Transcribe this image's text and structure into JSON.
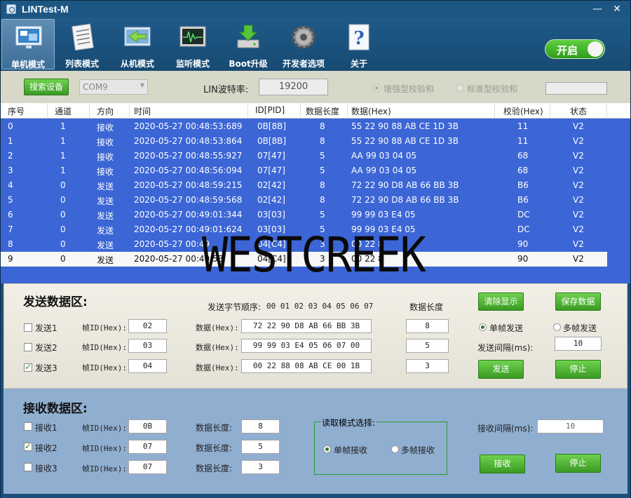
{
  "window": {
    "title": "LINTest-M",
    "minimize": "—",
    "close": "✕"
  },
  "toolbar": {
    "items": [
      {
        "label": "单机模式",
        "icon": "monitor-windows-icon"
      },
      {
        "label": "列表模式",
        "icon": "notebook-list-icon"
      },
      {
        "label": "从机模式",
        "icon": "arrow-window-icon"
      },
      {
        "label": "监听模式",
        "icon": "oscilloscope-icon"
      },
      {
        "label": "Boot升级",
        "icon": "download-disk-icon"
      },
      {
        "label": "开发者选项",
        "icon": "gear-icon"
      },
      {
        "label": "关于",
        "icon": "question-icon"
      }
    ],
    "toggle_label": "开启"
  },
  "device": {
    "search_button": "搜索设备",
    "port": "COM9",
    "baud_label": "LIN波特率:",
    "baud_value": "19200",
    "checksum_enhanced": "增强型校验和",
    "checksum_standard": "标准型校验和"
  },
  "table": {
    "columns": [
      "序号",
      "通道",
      "方向",
      "时间",
      "ID[PID]",
      "数据长度",
      "数据(Hex)",
      "校验(Hex)",
      "状态"
    ],
    "rows": [
      [
        "0",
        "1",
        "接收",
        "2020-05-27 00:48:53:689",
        "0B[8B]",
        "8",
        "55 22 90 88 AB CE 1D 3B",
        "11",
        "V2"
      ],
      [
        "1",
        "1",
        "接收",
        "2020-05-27 00:48:53:864",
        "0B[8B]",
        "8",
        "55 22 90 88 AB CE 1D 3B",
        "11",
        "V2"
      ],
      [
        "2",
        "1",
        "接收",
        "2020-05-27 00:48:55:927",
        "07[47]",
        "5",
        "AA 99 03 04 05",
        "68",
        "V2"
      ],
      [
        "3",
        "1",
        "接收",
        "2020-05-27 00:48:56:094",
        "07[47]",
        "5",
        "AA 99 03 04 05",
        "68",
        "V2"
      ],
      [
        "4",
        "0",
        "发送",
        "2020-05-27 00:48:59:215",
        "02[42]",
        "8",
        "72 22 90 D8 AB 66 BB 3B",
        "B6",
        "V2"
      ],
      [
        "5",
        "0",
        "发送",
        "2020-05-27 00:48:59:568",
        "02[42]",
        "8",
        "72 22 90 D8 AB 66 BB 3B",
        "B6",
        "V2"
      ],
      [
        "6",
        "0",
        "发送",
        "2020-05-27 00:49:01:344",
        "03[03]",
        "5",
        "99 99 03 E4 05",
        "DC",
        "V2"
      ],
      [
        "7",
        "0",
        "发送",
        "2020-05-27 00:49:01:624",
        "03[03]",
        "5",
        "99 99 03 E4 05",
        "DC",
        "V2"
      ],
      [
        "8",
        "0",
        "发送",
        "2020-05-27 00:49",
        "04[C4]",
        "3",
        "00 22 8",
        "90",
        "V2"
      ],
      [
        "9",
        "0",
        "发送",
        "2020-05-27 00:49:53",
        "04[C4]",
        "3",
        "00 22 8",
        "90",
        "V2"
      ]
    ],
    "selected_index": 9
  },
  "send": {
    "title": "发送数据区:",
    "byte_order_label": "发送字节顺序:",
    "byte_order_value": "00 01 02 03 04 05 06 07",
    "len_header": "数据长度",
    "frame_id_label": "帧ID(Hex):",
    "data_label": "数据(Hex):",
    "rows": [
      {
        "name": "发送1",
        "checked": false,
        "id": "02",
        "data": "72 22 90 D8 AB 66 BB 3B",
        "len": "8"
      },
      {
        "name": "发送2",
        "checked": false,
        "id": "03",
        "data": "99 99 03 E4 05 06 07 00",
        "len": "5"
      },
      {
        "name": "发送3",
        "checked": true,
        "id": "04",
        "data": "00 22 88 08 AB CE 00 1B",
        "len": "3"
      }
    ],
    "clear_button": "清除显示",
    "save_button": "保存数据",
    "single_frame": "单帧发送",
    "multi_frame": "多帧发送",
    "interval_label": "发送间隔(ms):",
    "interval_value": "10",
    "send_button": "发送",
    "stop_button": "停止"
  },
  "recv": {
    "title": "接收数据区:",
    "frame_id_label": "帧ID(Hex):",
    "len_label": "数据长度:",
    "rows": [
      {
        "name": "接收1",
        "checked": false,
        "id": "0B",
        "len": "8"
      },
      {
        "name": "接收2",
        "checked": true,
        "id": "07",
        "len": "5"
      },
      {
        "name": "接收3",
        "checked": false,
        "id": "07",
        "len": "3"
      }
    ],
    "mode_title": "读取模式选择:",
    "single_recv": "单帧接收",
    "multi_recv": "多帧接收",
    "interval_label": "接收间隔(ms):",
    "interval_value": "10",
    "recv_button": "接收",
    "stop_button": "停止"
  },
  "watermark": "WESTCREEK"
}
